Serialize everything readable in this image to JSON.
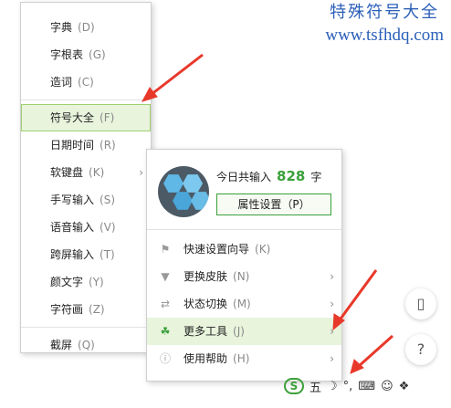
{
  "watermark": {
    "chinese": "特殊符号大全",
    "url": "www.tsfhdq.com"
  },
  "left_menu": {
    "group1": [
      {
        "label": "字典",
        "key": "(D)"
      },
      {
        "label": "字根表",
        "key": "(G)"
      },
      {
        "label": "造词",
        "key": "(C)"
      }
    ],
    "group2": [
      {
        "label": "符号大全",
        "key": "(F)"
      },
      {
        "label": "日期时间",
        "key": "(R)"
      },
      {
        "label": "软键盘",
        "key": "(K)"
      },
      {
        "label": "手写输入",
        "key": "(S)"
      },
      {
        "label": "语音输入",
        "key": "(V)"
      },
      {
        "label": "跨屏输入",
        "key": "(T)"
      },
      {
        "label": "颜文字",
        "key": "(Y)"
      },
      {
        "label": "字符画",
        "key": "(Z)"
      }
    ],
    "group3": [
      {
        "label": "截屏",
        "key": "(Q)"
      }
    ],
    "active": "符号大全"
  },
  "right_panel": {
    "today_label": "今日共输入",
    "today_count": "828",
    "today_unit": "字",
    "prop_button": "属性设置（P）",
    "items": [
      {
        "label": "快速设置向导",
        "key": "(K)",
        "icon": "flag-icon"
      },
      {
        "label": "更换皮肤",
        "key": "(N)",
        "icon": "shirt-icon"
      },
      {
        "label": "状态切换",
        "key": "(M)",
        "icon": "swap-icon"
      },
      {
        "label": "更多工具",
        "key": "(J)",
        "icon": "clover-icon"
      },
      {
        "label": "使用帮助",
        "key": "(H)",
        "icon": "help-icon"
      }
    ],
    "active": "更多工具"
  },
  "side_buttons": {
    "help": "?"
  },
  "toolbar": {
    "wu": "五",
    "punct": "°,"
  },
  "colors": {
    "accent": "#3aa03a",
    "highlight_bg": "#e8f4dc",
    "watermark": "#2b5fb8",
    "arrow": "#e8382a"
  }
}
